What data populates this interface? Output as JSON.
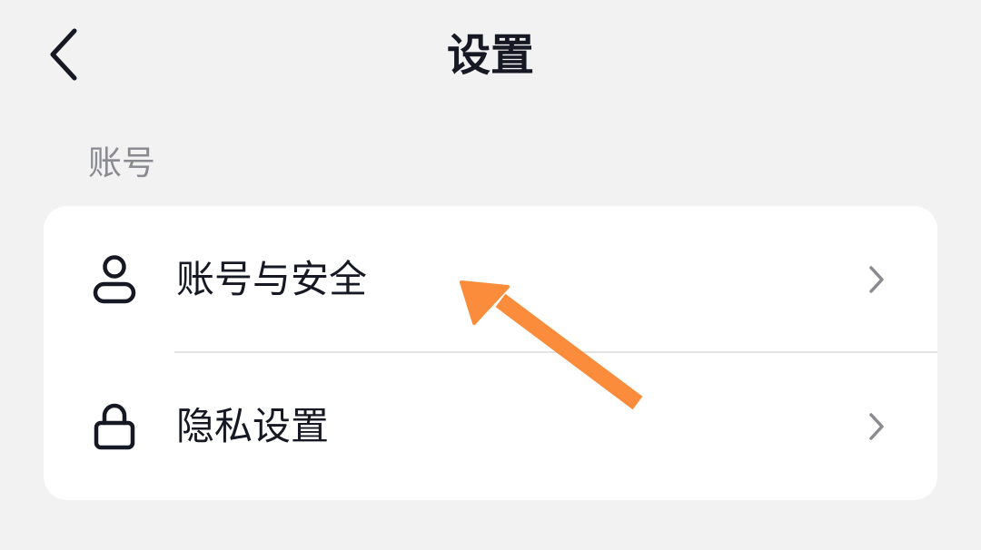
{
  "header": {
    "title": "设置",
    "back_icon": "chevron-left-icon"
  },
  "section": {
    "label": "账号"
  },
  "rows": [
    {
      "label": "账号与安全",
      "icon": "user-icon",
      "chevron": "chevron-right-icon"
    },
    {
      "label": "隐私设置",
      "icon": "lock-icon",
      "chevron": "chevron-right-icon"
    }
  ],
  "colors": {
    "background": "#f2f2f2",
    "card": "#ffffff",
    "text_primary": "#161823",
    "text_secondary": "#8a8b91",
    "chevron": "#8a8b91",
    "divider": "#e3e3e4",
    "annotation_arrow": "#fa8c3c"
  },
  "annotation": {
    "type": "arrow",
    "points_to": "账号与安全"
  }
}
